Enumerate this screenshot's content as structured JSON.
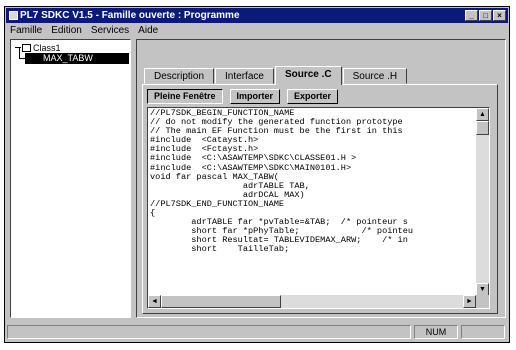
{
  "window": {
    "title": "PL7 SDKC V1.5 - Famille ouverte : Programme",
    "controls": [
      "minimize-icon",
      "maximize-icon",
      "close-icon"
    ]
  },
  "menu": [
    "Famille",
    "Edition",
    "Services",
    "Aide"
  ],
  "tree": {
    "root": "Class1",
    "child": "MAX_TABW"
  },
  "tabs": [
    {
      "label": "Description",
      "active": false
    },
    {
      "label": "Interface",
      "active": false
    },
    {
      "label": "Source .C",
      "active": true
    },
    {
      "label": "Source .H",
      "active": false
    }
  ],
  "buttons": {
    "fullscreen": "Pleine Fenêtre",
    "import": "Importer",
    "export": "Exporter"
  },
  "code_lines": [
    "//PL7SDK_BEGIN_FUNCTION_NAME",
    "// do not modify the generated function prototype",
    "// The main EF Function must be the first in this",
    "#include  <Catayst.h>",
    "#include  <Fctayst.h>",
    "#include  <C:\\ASAWTEMP\\SDKC\\CLASSE01.H >",
    "#include  <C:\\ASAWTEMP\\SDKC\\MAIN0101.H>",
    "void far pascal MAX_TABW(",
    "                  adrTABLE TAB,",
    "                  adrDCAL MAX)",
    "//PL7SDK_END_FUNCTION_NAME",
    "{",
    "        adrTABLE far *pvTable=&TAB;  /* pointeur s",
    "        short far *pPhyTable;            /* pointeu",
    "        short Resultat= TABLEVIDEMAX_ARW;    /* in",
    "        short    TailleTab;"
  ],
  "status": {
    "num": "NUM"
  }
}
